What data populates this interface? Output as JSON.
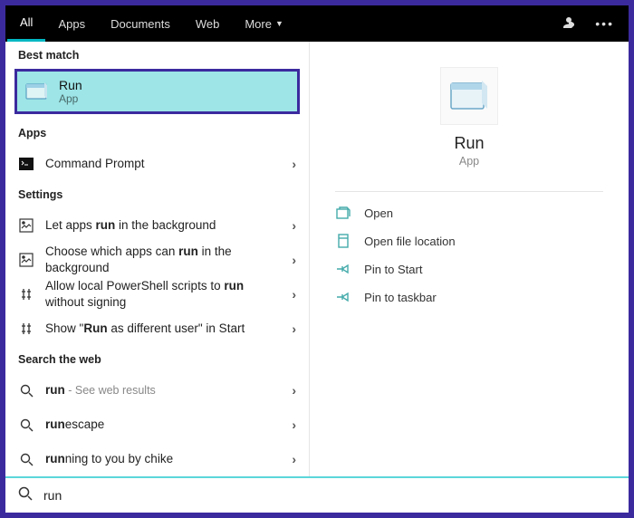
{
  "tabs": {
    "all": "All",
    "apps": "Apps",
    "documents": "Documents",
    "web": "Web",
    "more": "More"
  },
  "sections": {
    "bestMatch": "Best match",
    "apps": "Apps",
    "settings": "Settings",
    "searchWeb": "Search the web"
  },
  "bestMatch": {
    "title": "Run",
    "subtitle": "App"
  },
  "appsList": {
    "commandPrompt": "Command Prompt"
  },
  "settingsList": {
    "bgApps_pre": "Let apps ",
    "bgApps_bold": "run",
    "bgApps_post": " in the background",
    "chooseBg_pre": "Choose which apps can ",
    "chooseBg_bold": "run",
    "chooseBg_post": " in the background",
    "ps_pre": "Allow local PowerShell scripts to ",
    "ps_bold": "run",
    "ps_post": " without signing",
    "diffUser_pre": "Show \"",
    "diffUser_bold": "Run",
    "diffUser_post": " as different user\" in Start"
  },
  "webList": {
    "run_bold": "run",
    "run_sub": " - See web results",
    "runescape_bold": "run",
    "runescape_rest": "escape",
    "running_bold": "run",
    "running_rest": "ning to you by chike"
  },
  "preview": {
    "title": "Run",
    "subtitle": "App"
  },
  "actions": {
    "open": "Open",
    "openLocation": "Open file location",
    "pinStart": "Pin to Start",
    "pinTaskbar": "Pin to taskbar"
  },
  "search": {
    "value": "run"
  }
}
